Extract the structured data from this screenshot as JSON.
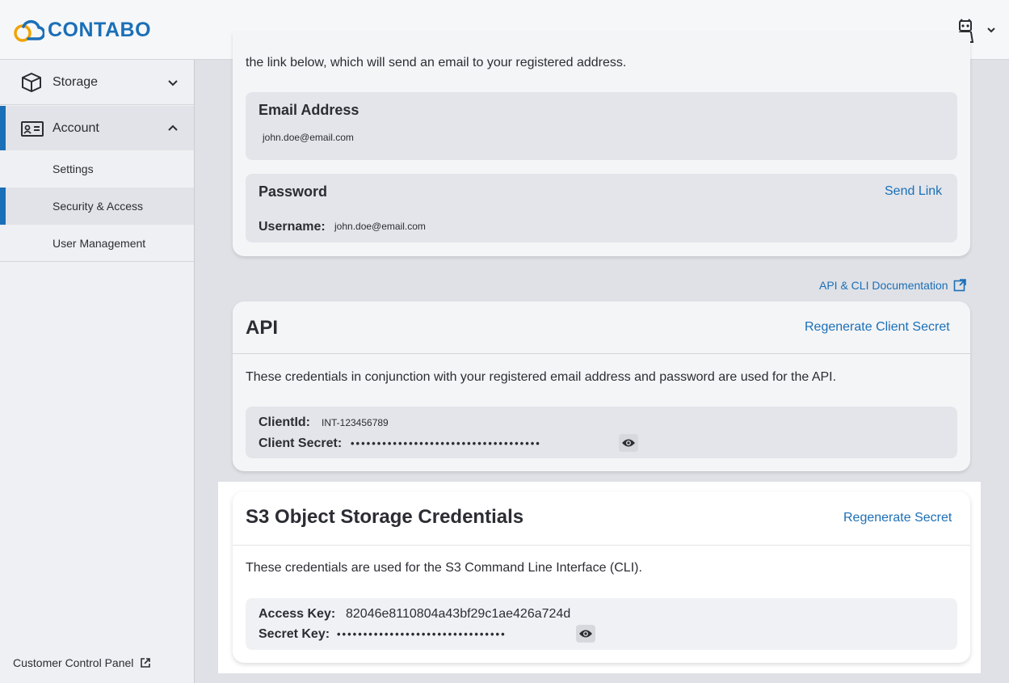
{
  "header": {
    "brand": "CONTABO",
    "avatar_icon": "robot-avatar-icon",
    "colors": {
      "brand_blue": "#1b6fb7",
      "brand_orange": "#f0a400"
    }
  },
  "sidebar": {
    "items": [
      {
        "label": "Storage",
        "icon": "box-icon"
      },
      {
        "label": "Account",
        "icon": "id-card-icon"
      }
    ],
    "subitems": [
      {
        "label": "Settings"
      },
      {
        "label": "Security & Access"
      },
      {
        "label": "User Management"
      }
    ],
    "footer_link": "Customer Control Panel"
  },
  "login_card": {
    "intro": "the link below, which will send an email to your registered address.",
    "email_label": "Email Address",
    "email_value": "john.doe@email.com",
    "password_label": "Password",
    "send_link": "Send Link",
    "username_label": "Username:",
    "username_value": "john.doe@email.com"
  },
  "doc_link": "API & CLI Documentation",
  "api_card": {
    "title": "API",
    "action": "Regenerate Client Secret",
    "description": "These credentials in conjunction with your registered email address and password are used for the API.",
    "client_id_label": "ClientId:",
    "client_id_value": "INT-123456789",
    "client_secret_label": "Client Secret:",
    "client_secret_masked": "••••••••••••••••••••••••••••••••••••"
  },
  "s3_card": {
    "title": "S3 Object Storage Credentials",
    "action": "Regenerate Secret",
    "description": "These credentials are used for the S3 Command Line Interface (CLI).",
    "access_key_label": "Access Key:",
    "access_key_value": "82046e8110804a43bf29c1ae426a724d",
    "secret_key_label": "Secret Key:",
    "secret_key_masked": "••••••••••••••••••••••••••••••••"
  }
}
